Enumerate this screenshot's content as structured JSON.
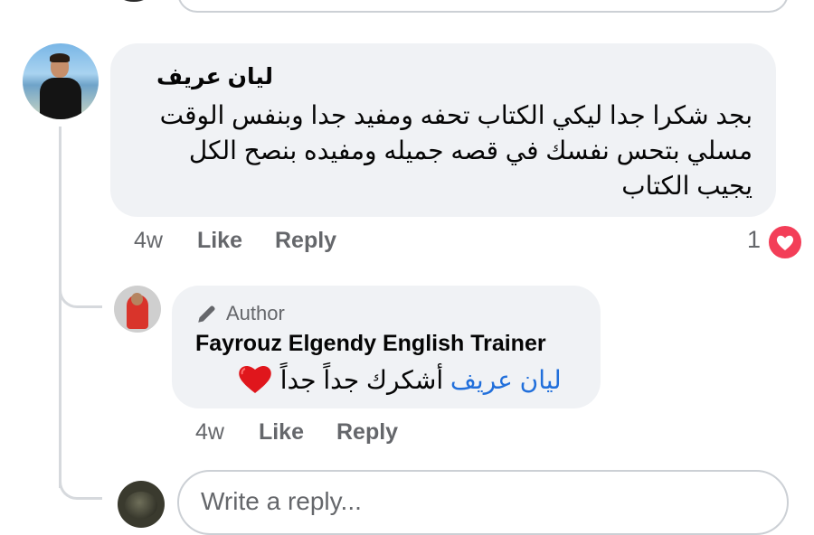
{
  "comment": {
    "author": "ليان عريف",
    "text": "بجد شكرا جدا ليكي الكتاب تحفه ومفيد جدا وبنفس الوقت مسلي بتحس نفسك في قصه جميله ومفيده بنصح الكل يجيب الكتاب",
    "time": "4w",
    "like_label": "Like",
    "reply_label": "Reply",
    "reaction_count": "1",
    "reaction_icon": "love-reaction-icon"
  },
  "reply": {
    "badge": "Author",
    "badge_icon": "pencil-icon",
    "author": "Fayrouz Elgendy English Trainer",
    "mention": "ليان عريف",
    "text": "أشكرك جداً جداً",
    "emoji": "red-heart",
    "time": "4w",
    "like_label": "Like",
    "reply_label": "Reply"
  },
  "composer": {
    "placeholder": "Write a reply..."
  },
  "colors": {
    "bubble": "#f0f2f5",
    "mention": "#216fdb",
    "muted": "#65676b",
    "love": "#f33e58"
  }
}
